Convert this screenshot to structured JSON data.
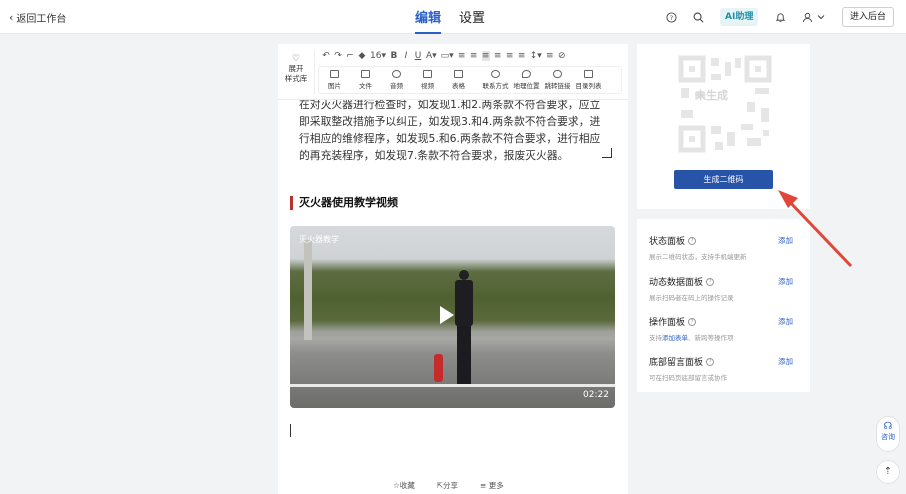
{
  "topbar": {
    "back_label": "返回工作台",
    "tabs": [
      {
        "label": "编辑"
      },
      {
        "label": "设置"
      }
    ],
    "ai_label": "AI助理",
    "enter_label": "进入后台",
    "icons": [
      "help-circle-icon",
      "search-icon",
      "bell-icon",
      "user-icon",
      "chevron-down-icon"
    ]
  },
  "toolbar": {
    "style_lib_line1": "展开",
    "style_lib_line2": "样式库",
    "font_size": "16",
    "insert_items": [
      {
        "label": "图片",
        "icon": "image-icon"
      },
      {
        "label": "文件",
        "icon": "file-icon"
      },
      {
        "label": "音频",
        "icon": "audio-icon"
      },
      {
        "label": "视频",
        "icon": "video-icon"
      },
      {
        "label": "表格",
        "icon": "table-icon"
      },
      {
        "label": "联系方式",
        "icon": "phone-icon"
      },
      {
        "label": "地理位置",
        "icon": "location-icon"
      },
      {
        "label": "跳转链接",
        "icon": "link-icon"
      },
      {
        "label": "目录列表",
        "icon": "list-icon"
      }
    ]
  },
  "content": {
    "paragraph": "在对灭火器进行检查时，如发现1.和2.两条款不符合要求，应立即采取整改措施予以纠正，如发现3.和4.两条款不符合要求，进行相应的维修程序，如发现5.和6.两条款不符合要求，进行相应的再充装程序，如发现7.条款不符合要求，报废灭火器。",
    "heading": "灭火器使用教学视频",
    "video_title": "灭火器教学",
    "video_duration": "02:22"
  },
  "bottom_actions": [
    {
      "label": "收藏"
    },
    {
      "label": "分享"
    },
    {
      "label": "更多"
    }
  ],
  "qr": {
    "placeholder_label": "未生成",
    "generate_label": "生成二维码"
  },
  "panels": [
    {
      "title": "状态面板",
      "desc": "展示二维码状态，支持手机端更新",
      "add": "添加"
    },
    {
      "title": "动态数据面板",
      "desc": "展示扫码者在码上的操作记录",
      "add": "添加"
    },
    {
      "title": "操作面板",
      "desc_pre": "支持",
      "desc_link": "添加表单",
      "desc_post": "、新跨等操作项",
      "add": "添加"
    },
    {
      "title": "底部留言面板",
      "desc": "可在扫码页底部留言或协作",
      "add": "添加"
    }
  ],
  "float": {
    "help_label": "咨询"
  },
  "colors": {
    "accent": "#2a5fc6",
    "generate_button": "#2754a8",
    "annotation_arrow": "#e0473b",
    "heading_bar": "#b5332b"
  }
}
